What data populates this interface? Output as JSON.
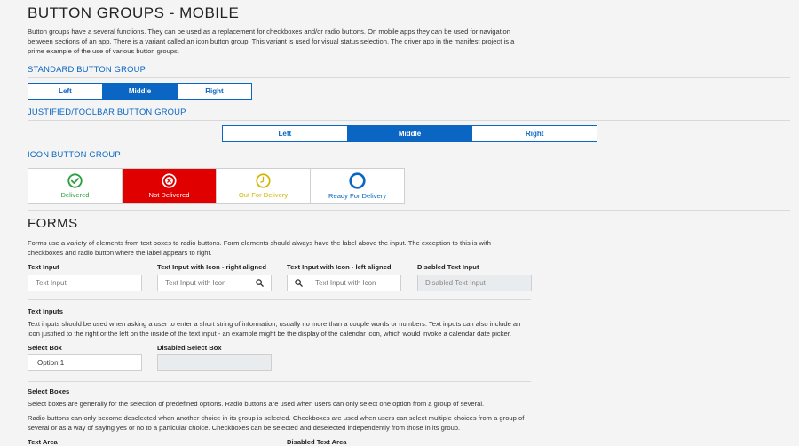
{
  "page_title": "BUTTON GROUPS - MOBILE",
  "intro": "Button groups have a several functions. They can be used as a replacement for checkboxes and/or radio buttons. On mobile apps they can be used for navigation between sections of an app. There is a variant called an icon button group. This variant is used for visual status selection. The driver app in the manifest project is a prime example of the use of various button groups.",
  "standard_group": {
    "title": "STANDARD BUTTON GROUP",
    "buttons": [
      "Left",
      "Middle",
      "Right"
    ],
    "active": "Middle"
  },
  "justified_group": {
    "title": "JUSTIFIED/TOOLBAR BUTTON GROUP",
    "buttons": [
      "Left",
      "Middle",
      "Right"
    ],
    "active": "Middle"
  },
  "icon_group": {
    "title": "ICON BUTTON GROUP",
    "items": [
      {
        "label": "Delivered",
        "icon": "check-circle-icon",
        "color": "#2e9e3e"
      },
      {
        "label": "Not Delivered",
        "icon": "x-circle-icon",
        "color": "#ffffff",
        "active": true
      },
      {
        "label": "Out For Delivery",
        "icon": "clock-icon",
        "color": "#d4b400"
      },
      {
        "label": "Ready For Delivery",
        "icon": "ring-icon",
        "color": "#0a66c2"
      }
    ]
  },
  "forms": {
    "title": "FORMS",
    "intro": "Forms use a variety of elements from text boxes to radio buttons. Form elements should always have the label above the input. The exception to this is with checkboxes and radio button where the label appears to right.",
    "text_input": {
      "label": "Text Input",
      "placeholder": "Text Input"
    },
    "text_input_icon_right": {
      "label": "Text Input with Icon - right aligned",
      "placeholder": "Text Input with Icon"
    },
    "text_input_icon_left": {
      "label": "Text Input with Icon - left aligned",
      "placeholder": "Text Input with Icon"
    },
    "disabled_text_input": {
      "label": "Disabled Text Input",
      "placeholder": "Disabled Text Input"
    },
    "text_inputs_heading": "Text Inputs",
    "text_inputs_desc": "Text inputs should be used when asking a user to enter a short string of information, usually no more than a couple words or numbers. Text inputs can also include an icon justified to the right or the left on the inside of the text input - an example might be the display of the calendar icon, which would invoke a calendar date picker.",
    "select_box": {
      "label": "Select Box",
      "value": "Option 1"
    },
    "disabled_select_box": {
      "label": "Disabled Select Box",
      "value": ""
    },
    "select_boxes_heading": "Select Boxes",
    "select_boxes_desc1": "Select boxes are generally for the selection of predefined options. Radio buttons are used when users can only select one option from a group of several.",
    "select_boxes_desc2": "Radio buttons can only become deselected when another choice in its group is selected. Checkboxes are used when users can select multiple choices from a group of several or as a way of saying yes or no to a particular choice. Checkboxes can be selected and deselected independently from those in its group.",
    "text_area_label": "Text Area",
    "disabled_text_area_label": "Disabled Text Area"
  }
}
